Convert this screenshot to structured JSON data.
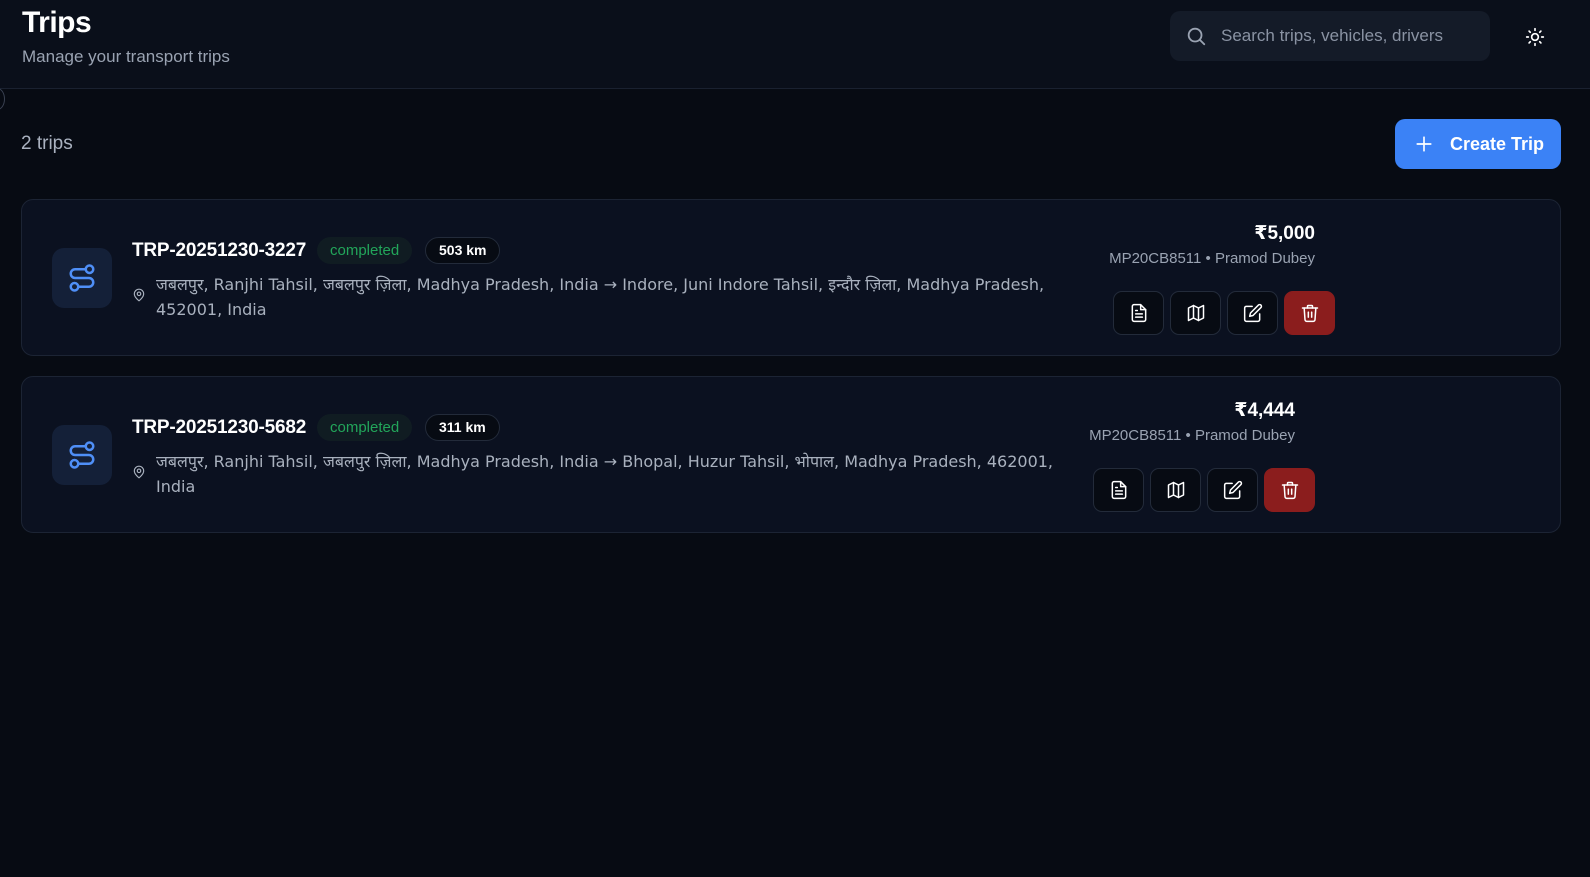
{
  "header": {
    "title": "Trips",
    "subtitle": "Manage your transport trips",
    "search_placeholder": "Search trips, vehicles, drivers",
    "theme_icon": "sun-icon"
  },
  "toolbar": {
    "trip_count": "2 trips",
    "create_label": "Create Trip"
  },
  "trips": [
    {
      "id": "TRP-20251230-3227",
      "status": "completed",
      "distance": "503 km",
      "route": "जबलपुर, Ranjhi Tahsil, जबलपुर ज़िला, Madhya Pradesh, India → Indore, Juni Indore Tahsil, इन्दौर ज़िला, Madhya Pradesh, 452001, India",
      "amount": "₹5,000",
      "vehicle_driver": "MP20CB8511 • Pramod Dubey"
    },
    {
      "id": "TRP-20251230-5682",
      "status": "completed",
      "distance": "311 km",
      "route": "जबलपुर, Ranjhi Tahsil, जबलपुर ज़िला, Madhya Pradesh, India → Bhopal, Huzur Tahsil, भोपाल, Madhya Pradesh, 462001, India",
      "amount": "₹4,444",
      "vehicle_driver": "MP20CB8511 • Pramod Dubey"
    }
  ],
  "colors": {
    "accent": "#3b82f6",
    "status_completed": "#22a55a",
    "danger": "#8b1d1d",
    "background": "#070b13"
  }
}
